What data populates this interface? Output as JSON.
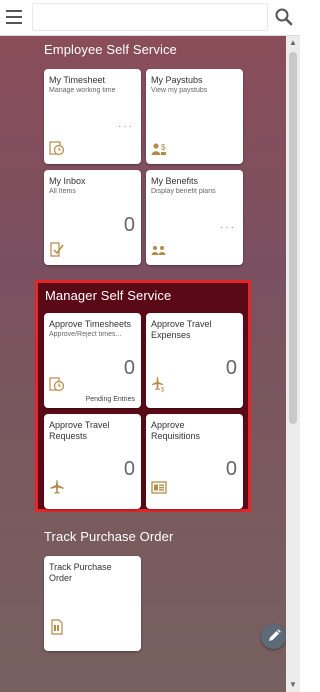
{
  "colors": {
    "accent": "#b48b4a",
    "highlight_border": "#e3262a",
    "section_bg": "#8a4d5a",
    "mss_bg": "#5a0a16"
  },
  "topbar": {
    "menu_icon": "hamburger-icon",
    "search_placeholder": "",
    "search_icon": "search-icon"
  },
  "sections": {
    "employee": {
      "title": "Employee Self Service",
      "tiles": [
        {
          "title": "My Timesheet",
          "subtitle": "Manage working time",
          "icon": "clock-icon",
          "extra": "···"
        },
        {
          "title": "My Paystubs",
          "subtitle": "View my paystubs",
          "icon": "paystub-icon"
        },
        {
          "title": "My Inbox",
          "subtitle": "All Items",
          "icon": "inbox-icon",
          "count": "0"
        },
        {
          "title": "My Benefits",
          "subtitle": "Display benefit plans",
          "icon": "benefits-icon",
          "extra": "···"
        }
      ]
    },
    "manager": {
      "title": "Manager Self Service",
      "tiles": [
        {
          "title": "Approve Timesheets",
          "subtitle": "Approve/Reject times...",
          "icon": "timesheet-approve-icon",
          "count": "0",
          "footer": "Pending Entries"
        },
        {
          "title": "Approve Travel Expenses",
          "icon": "travel-expense-icon",
          "count": "0"
        },
        {
          "title": "Approve Travel Requests",
          "icon": "airplane-icon",
          "count": "0"
        },
        {
          "title": "Approve Requisitions",
          "icon": "requisition-icon",
          "count": "0"
        }
      ]
    },
    "purchase": {
      "title": "Track Purchase Order",
      "tiles": [
        {
          "title": "Track Purchase Order",
          "icon": "purchase-order-icon"
        }
      ]
    }
  },
  "edit_icon": "pencil-icon"
}
